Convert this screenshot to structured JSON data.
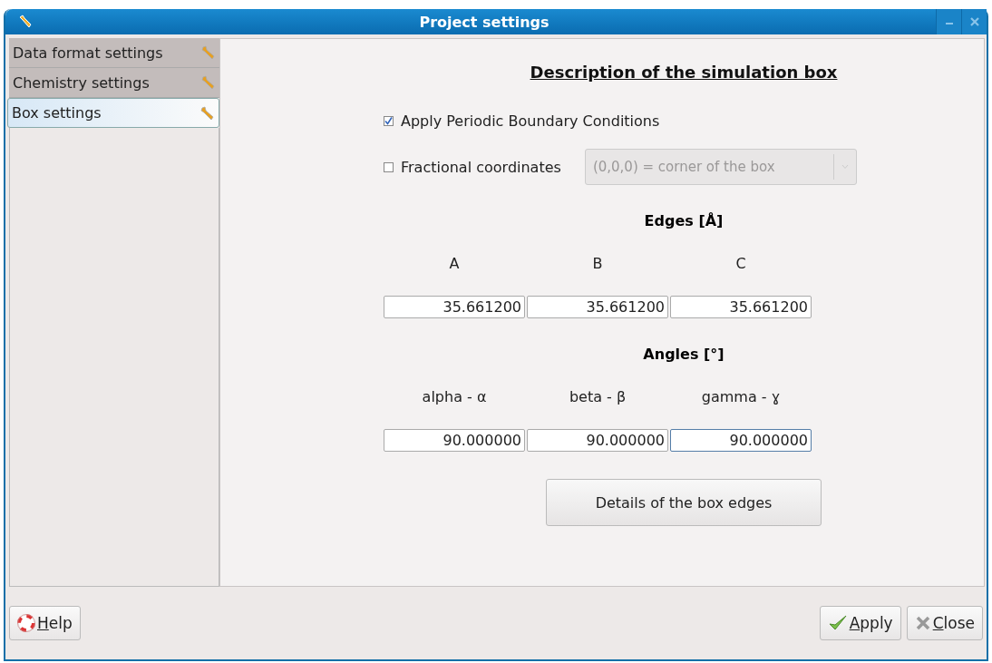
{
  "window": {
    "title": "Project settings"
  },
  "sidebar": {
    "items": [
      {
        "label": "Data format settings",
        "selected": false
      },
      {
        "label": "Chemistry settings",
        "selected": false
      },
      {
        "label": "Box settings",
        "selected": true
      }
    ]
  },
  "heading": "Description of the simulation box",
  "options": [
    {
      "label": "Apply Periodic Boundary Conditions",
      "checked": true
    },
    {
      "label": "Fractional coordinates",
      "checked": false,
      "dropdown": {
        "value": "(0,0,0) = corner of the box",
        "disabled": true
      }
    }
  ],
  "edges": {
    "title": "Edges [Å]",
    "fields": [
      {
        "label": "A",
        "value": "35.661200",
        "focused": false
      },
      {
        "label": "B",
        "value": "35.661200",
        "focused": false
      },
      {
        "label": "C",
        "value": "35.661200",
        "focused": false
      }
    ]
  },
  "angles": {
    "title": "Angles [°]",
    "fields": [
      {
        "label": "alpha - α",
        "value": "90.000000",
        "focused": false
      },
      {
        "label": "beta - β",
        "value": "90.000000",
        "focused": false
      },
      {
        "label": "gamma - ɣ",
        "value": "90.000000",
        "focused": true
      }
    ]
  },
  "details_button": "Details of the box edges",
  "buttons": [
    {
      "label": "Help",
      "kind": "help"
    },
    {
      "label": "Apply",
      "kind": "apply"
    },
    {
      "label": "Close",
      "kind": "close"
    }
  ]
}
